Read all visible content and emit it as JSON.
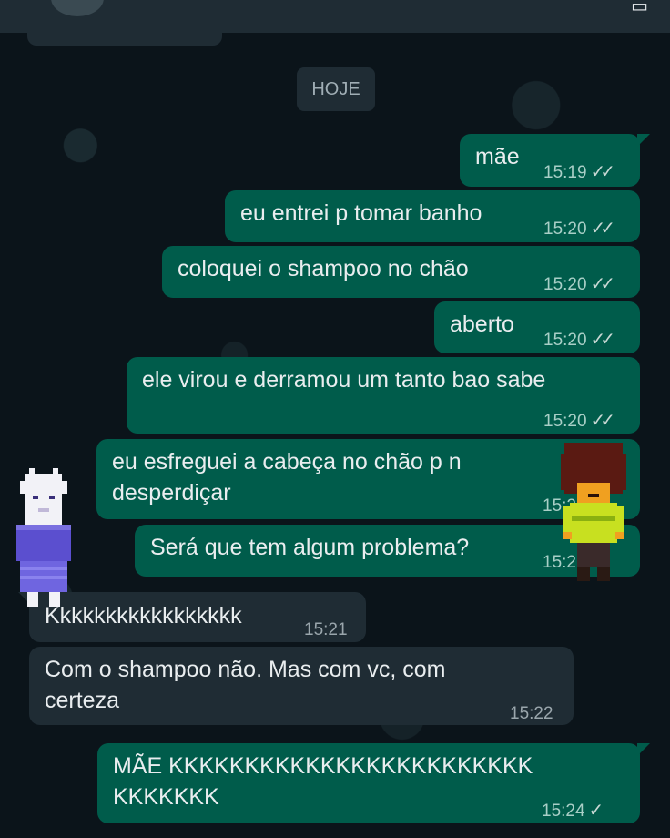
{
  "date_divider": "HOJE",
  "messages": [
    {
      "text": "mãe",
      "time": "15:19",
      "status": "read"
    },
    {
      "text": "eu entrei p tomar banho",
      "time": "15:20",
      "status": "read"
    },
    {
      "text": "coloquei o shampoo no chão",
      "time": "15:20",
      "status": "read"
    },
    {
      "text": "aberto",
      "time": "15:20",
      "status": "read"
    },
    {
      "text": "ele virou e derramou um tanto bao sabe",
      "time": "15:20",
      "status": "read"
    },
    {
      "text": "eu esfreguei a cabeça no chão p n\ndesperdiçar",
      "time": "15:2",
      "status": "read"
    },
    {
      "text": "Será que tem algum problema?",
      "time": "15:2",
      "status": "read"
    },
    {
      "text": "Kkkkkkkkkkkkkkkkk",
      "time": "15:21"
    },
    {
      "text": "Com o shampoo não. Mas com vc, com\ncerteza",
      "time": "15:22"
    },
    {
      "text": "MÃE KKKKKKKKKKKKKKKKKKKKKKKK\nKKKKKKK",
      "time": "15:24",
      "status": "sent"
    }
  ],
  "icons": {
    "read": "double-check-icon",
    "sent": "single-check-icon"
  },
  "colors": {
    "outgoing": "#005c4b",
    "incoming": "#1f2c34",
    "background": "#0b141a"
  }
}
